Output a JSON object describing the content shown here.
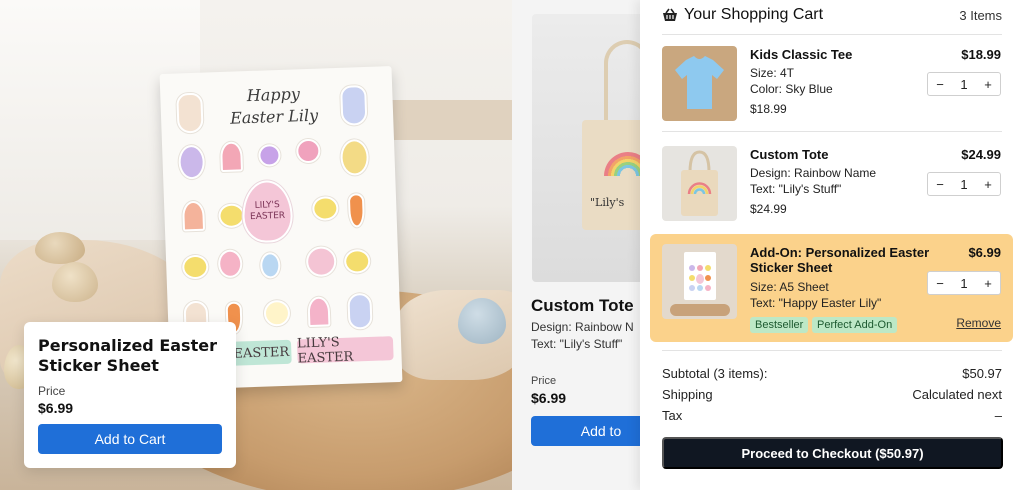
{
  "product": {
    "sheet_title": "Happy Easter Lily",
    "center_egg_text": "LILY'S EASTER",
    "banner_left": "EASTER",
    "banner_right": "LILY'S EASTER",
    "name": "Personalized Easter Sticker Sheet",
    "price_label": "Price",
    "price": "$6.99",
    "add_to_cart": "Add to Cart"
  },
  "tote_preview": {
    "tote_text": "\"Lily's",
    "title": "Custom Tote",
    "design_line": "Design: Rainbow N",
    "text_line": "Text: \"Lily's Stuff\"",
    "price_label": "Price",
    "price": "$6.99",
    "add_button": "Add to"
  },
  "cart": {
    "title": "Your Shopping Cart",
    "item_count": "3 Items",
    "items": [
      {
        "name": "Kids Classic Tee",
        "line1": "Size: 4T",
        "line2": "Color: Sky Blue",
        "unit_price": "$18.99",
        "price": "$18.99",
        "qty": "1",
        "color": "#7fc0ea"
      },
      {
        "name": "Custom Tote",
        "line1": "Design: Rainbow Name",
        "line2": "Text: \"Lily's Stuff\"",
        "unit_price": "$24.99",
        "price": "$24.99",
        "qty": "1"
      },
      {
        "name": "Add-On: Personalized Easter Sticker Sheet",
        "line1": "Size: A5 Sheet",
        "line2": "Text: \"Happy Easter Lily\"",
        "price": "$6.99",
        "qty": "1",
        "badges": [
          "Bestseller",
          "Perfect Add-On"
        ],
        "remove": "Remove"
      }
    ],
    "summary": {
      "subtotal_label": "Subtotal (3 items):",
      "subtotal": "$50.97",
      "shipping_label": "Shipping",
      "shipping": "Calculated next",
      "tax_label": "Tax",
      "tax": "–"
    },
    "checkout": "Proceed to Checkout ($50.97)",
    "qty_minus": "−",
    "qty_plus": "+"
  },
  "colors": {
    "accent_blue": "#1f6fd8",
    "highlight": "#fbd28b",
    "checkout_bg": "#101722",
    "badge_green": "#bde8c6"
  }
}
